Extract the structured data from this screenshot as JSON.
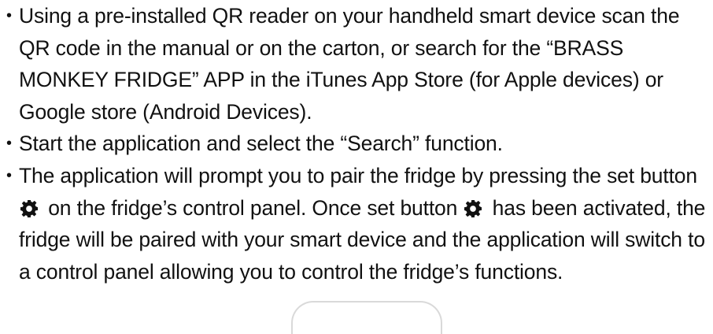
{
  "instructions": [
    {
      "text": "Using a pre-installed QR reader on your handheld smart device scan the QR code in the manual or on the carton, or search for the “BRASS MONKEY FRIDGE” APP in the iTunes App Store (for Apple devices) or Google store (Android Devices)."
    },
    {
      "text": "Start the application and select the “Search” function."
    },
    {
      "part1": "The application will prompt you to pair the fridge by pressing the set button",
      "part2": "on the fridge’s control panel. Once set button",
      "part3": "has been activated, the fridge will be paired with your smart device and the application will switch to a control panel allowing you to control the fridge’s functions.",
      "icon": "gear-icon"
    }
  ],
  "bullet_char": "•",
  "colors": {
    "text": "#111111",
    "icon": "#111111"
  }
}
